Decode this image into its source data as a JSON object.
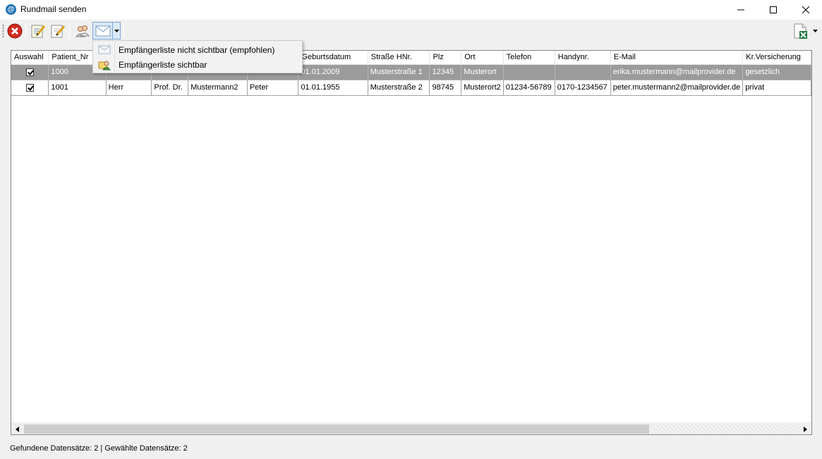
{
  "window": {
    "title": "Rundmail senden",
    "app_icon_glyph": "@"
  },
  "toolbar": {
    "icons": [
      "cancel-icon",
      "edit-list-icon",
      "edit-note-icon",
      "users-icon",
      "mail-icon",
      "export-excel-icon"
    ]
  },
  "dropdown": {
    "items": [
      {
        "label": "Empfängerliste nicht sichtbar (empfohlen)",
        "icon": "mail-icon"
      },
      {
        "label": "Empfängerliste sichtbar",
        "icon": "contacts-icon"
      }
    ]
  },
  "grid": {
    "columns": [
      "Auswahl",
      "Patient_Nr",
      "",
      "",
      "",
      "",
      "Geburtsdatum",
      "Straße HNr.",
      "Plz",
      "Ort",
      "Telefon",
      "Handynr.",
      "E-Mail",
      "Kr.Versicherung"
    ],
    "rows": [
      {
        "selected": true,
        "checked": true,
        "cells": [
          "1000",
          "",
          "",
          "",
          "",
          "01.01.2009",
          "Musterstraße 1",
          "12345",
          "Musterort",
          "",
          "",
          "erika.mustermann@mailprovider.de",
          "gesetzlich"
        ]
      },
      {
        "selected": false,
        "checked": true,
        "cells": [
          "1001",
          "Herr",
          "Prof. Dr.",
          "Mustermann2",
          "Peter",
          "01.01.1955",
          "Musterstraße 2",
          "98745",
          "Musterort2",
          "01234-56789",
          "0170-1234567",
          "peter.mustermann2@mailprovider.de",
          "privat"
        ]
      }
    ]
  },
  "status": {
    "text": "Gefundene Datensätze: 2 | Gewählte Datensätze: 2"
  },
  "colors": {
    "selected_row": "#9b9b9b",
    "menu_highlight": "#dbe9f7"
  }
}
